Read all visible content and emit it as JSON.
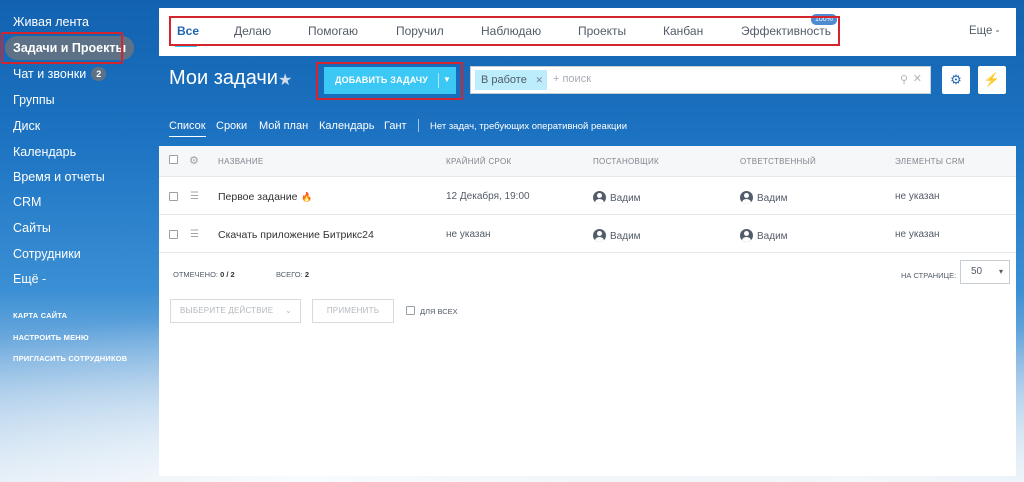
{
  "sidebar": {
    "items": [
      {
        "label": "Живая лента"
      },
      {
        "label": "Задачи и Проекты"
      },
      {
        "label": "Чат и звонки",
        "badge": "2"
      },
      {
        "label": "Группы"
      },
      {
        "label": "Диск"
      },
      {
        "label": "Календарь"
      },
      {
        "label": "Время и отчеты"
      },
      {
        "label": "CRM"
      },
      {
        "label": "Сайты"
      },
      {
        "label": "Сотрудники"
      },
      {
        "label": "Ещё -"
      }
    ],
    "links": [
      "Карта сайта",
      "Настроить меню",
      "Пригласить сотрудников"
    ]
  },
  "topbar": {
    "tabs": [
      "Все",
      "Делаю",
      "Помогаю",
      "Поручил",
      "Наблюдаю",
      "Проекты",
      "Канбан",
      "Эффективность"
    ],
    "efficiency_badge": "100%",
    "more": "Еще -"
  },
  "header": {
    "title": "Мои задачи",
    "add_button": "Добавить задачу",
    "filter_chip": "В работе",
    "search_placeholder": "+ поиск"
  },
  "views": {
    "items": [
      "Список",
      "Сроки",
      "Мой план",
      "Календарь",
      "Гант"
    ],
    "note": "Нет задач, требующих оперативной реакции"
  },
  "table": {
    "columns": [
      "Название",
      "Крайний срок",
      "Постановщик",
      "Ответственный",
      "Элементы CRM"
    ],
    "rows": [
      {
        "name": "Первое задание",
        "deadline": "12 Декабря, 19:00",
        "creator": "Вадим",
        "responsible": "Вадим",
        "crm": "не указан"
      },
      {
        "name": "Скачать приложение Битрикс24",
        "deadline": "не указан",
        "creator": "Вадим",
        "responsible": "Вадим",
        "crm": "не указан"
      }
    ]
  },
  "footer": {
    "marked_label": "Отмечено:",
    "marked_value": "0 / 2",
    "total_label": "Всего:",
    "total_value": "2",
    "per_page_label": "На странице:",
    "per_page_value": "50",
    "action_select": "Выберите действие",
    "apply_button": "Применить",
    "for_all": "Для всех"
  },
  "colors": {
    "accent": "#3bc8f5",
    "highlight": "#d4242d",
    "link_blue": "#2067b0",
    "fire": "#f48426"
  }
}
